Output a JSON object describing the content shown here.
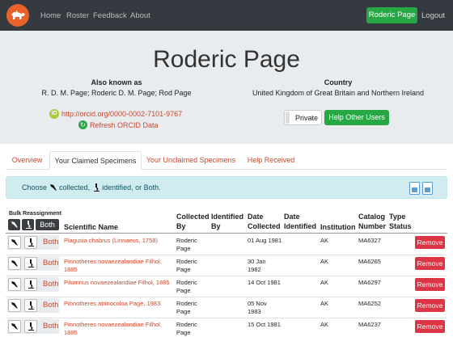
{
  "nav": {
    "links": [
      "Home",
      "Roster",
      "Feedback",
      "About"
    ],
    "user_button": "Roderic Page",
    "logout": "Logout"
  },
  "profile": {
    "name": "Roderic Page",
    "aka_heading": "Also known as",
    "aka_value": "R. D. M. Page; Roderic D. M. Page; Rod Page",
    "country_heading": "Country",
    "country_value": "United Kingdom of Great Britain and Northern Ireland",
    "orcid_url": "http://orcid.org/0000-0002-7101-9767",
    "refresh_label": "Refresh ORCID Data",
    "privacy_label": "Private",
    "help_button": "Help Other Users"
  },
  "tabs": [
    "Overview",
    "Your Claimed Specimens",
    "Your Unclaimed Specimens",
    "Help Received"
  ],
  "info": {
    "choose": "Choose",
    "collected": "collected,",
    "identified": "identified, or Both."
  },
  "table": {
    "bulk_label": "Bulk Reassignment",
    "both_label": "Both",
    "headers": {
      "scientific_name": "Scientific Name",
      "collected_by": [
        "Collected",
        "By"
      ],
      "identified_by": [
        "Identified",
        "By"
      ],
      "date_collected": [
        "Date",
        "Collected"
      ],
      "date_identified": [
        "Date",
        "Identified"
      ],
      "institution": "Institution",
      "catalog_number": [
        "Catalog",
        "Number"
      ],
      "type_status": [
        "Type",
        "Status"
      ]
    },
    "remove_label": "Remove",
    "rows": [
      {
        "name": [
          "Plagusia chabrus (Linnaeus, 1758)"
        ],
        "collector": [
          "Roderic",
          "Page"
        ],
        "date": [
          "01 Aug 1981"
        ],
        "institution": "AK",
        "catalog": "MA6327"
      },
      {
        "name": [
          "Pinnotheres novaezealandiae Filhol,",
          "1885"
        ],
        "collector": [
          "Roderic",
          "Page"
        ],
        "date": [
          "30 Jan",
          "1982"
        ],
        "institution": "AK",
        "catalog": "MA6265"
      },
      {
        "name": [
          "Pilumnus novaezealandiae Filhol, 1885"
        ],
        "collector": [
          "Roderic",
          "Page"
        ],
        "date": [
          "14 Oct 1981"
        ],
        "institution": "AK",
        "catalog": "MA6297"
      },
      {
        "name": [
          "Pinnotheres atrinocoloa Page, 1983"
        ],
        "collector": [
          "Roderic",
          "Page"
        ],
        "date": [
          "05 Nov",
          "1983"
        ],
        "institution": "AK",
        "catalog": "MA6252"
      },
      {
        "name": [
          "Pinnotheres novaezealandiae Filhol,",
          "1885"
        ],
        "collector": [
          "Roderic",
          "Page"
        ],
        "date": [
          "15 Oct 1981"
        ],
        "institution": "AK",
        "catalog": "MA6237"
      }
    ]
  },
  "colors": {
    "navbar": "#343a40",
    "accent_green": "#28a745",
    "link": "#c9482c",
    "danger": "#dc3545",
    "info_bg": "#d1ecf1",
    "jumbotron": "#e9ecef"
  },
  "icons": [
    "dog-logo-icon",
    "orcid-icon",
    "refresh-icon",
    "collector-net-icon",
    "microscope-icon",
    "file-icon"
  ]
}
